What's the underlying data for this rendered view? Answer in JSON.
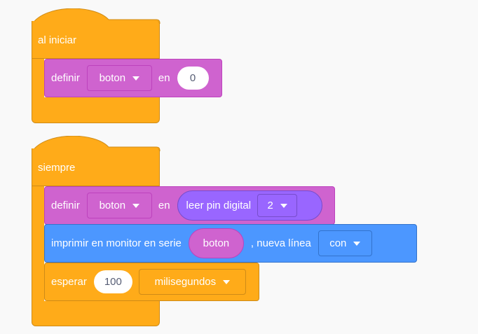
{
  "script1": {
    "hat_label": "al iniciar",
    "set_block": {
      "label": "definir",
      "variable": "boton",
      "in_label": "en",
      "value": "0"
    }
  },
  "script2": {
    "hat_label": "siempre",
    "set_block": {
      "label": "definir",
      "variable": "boton",
      "in_label": "en",
      "reporter_label": "leer pin digital",
      "pin": "2"
    },
    "print_block": {
      "label": "imprimir en monitor en serie",
      "reporter": "boton",
      "newline_label": ", nueva línea",
      "newline_option": "con"
    },
    "wait_block": {
      "label": "esperar",
      "value": "100",
      "unit": "milisegundos"
    }
  },
  "colors": {
    "control": "#ffab19",
    "variables": "#cf63cf",
    "serial": "#4c97ff",
    "input": "#9966ff"
  }
}
